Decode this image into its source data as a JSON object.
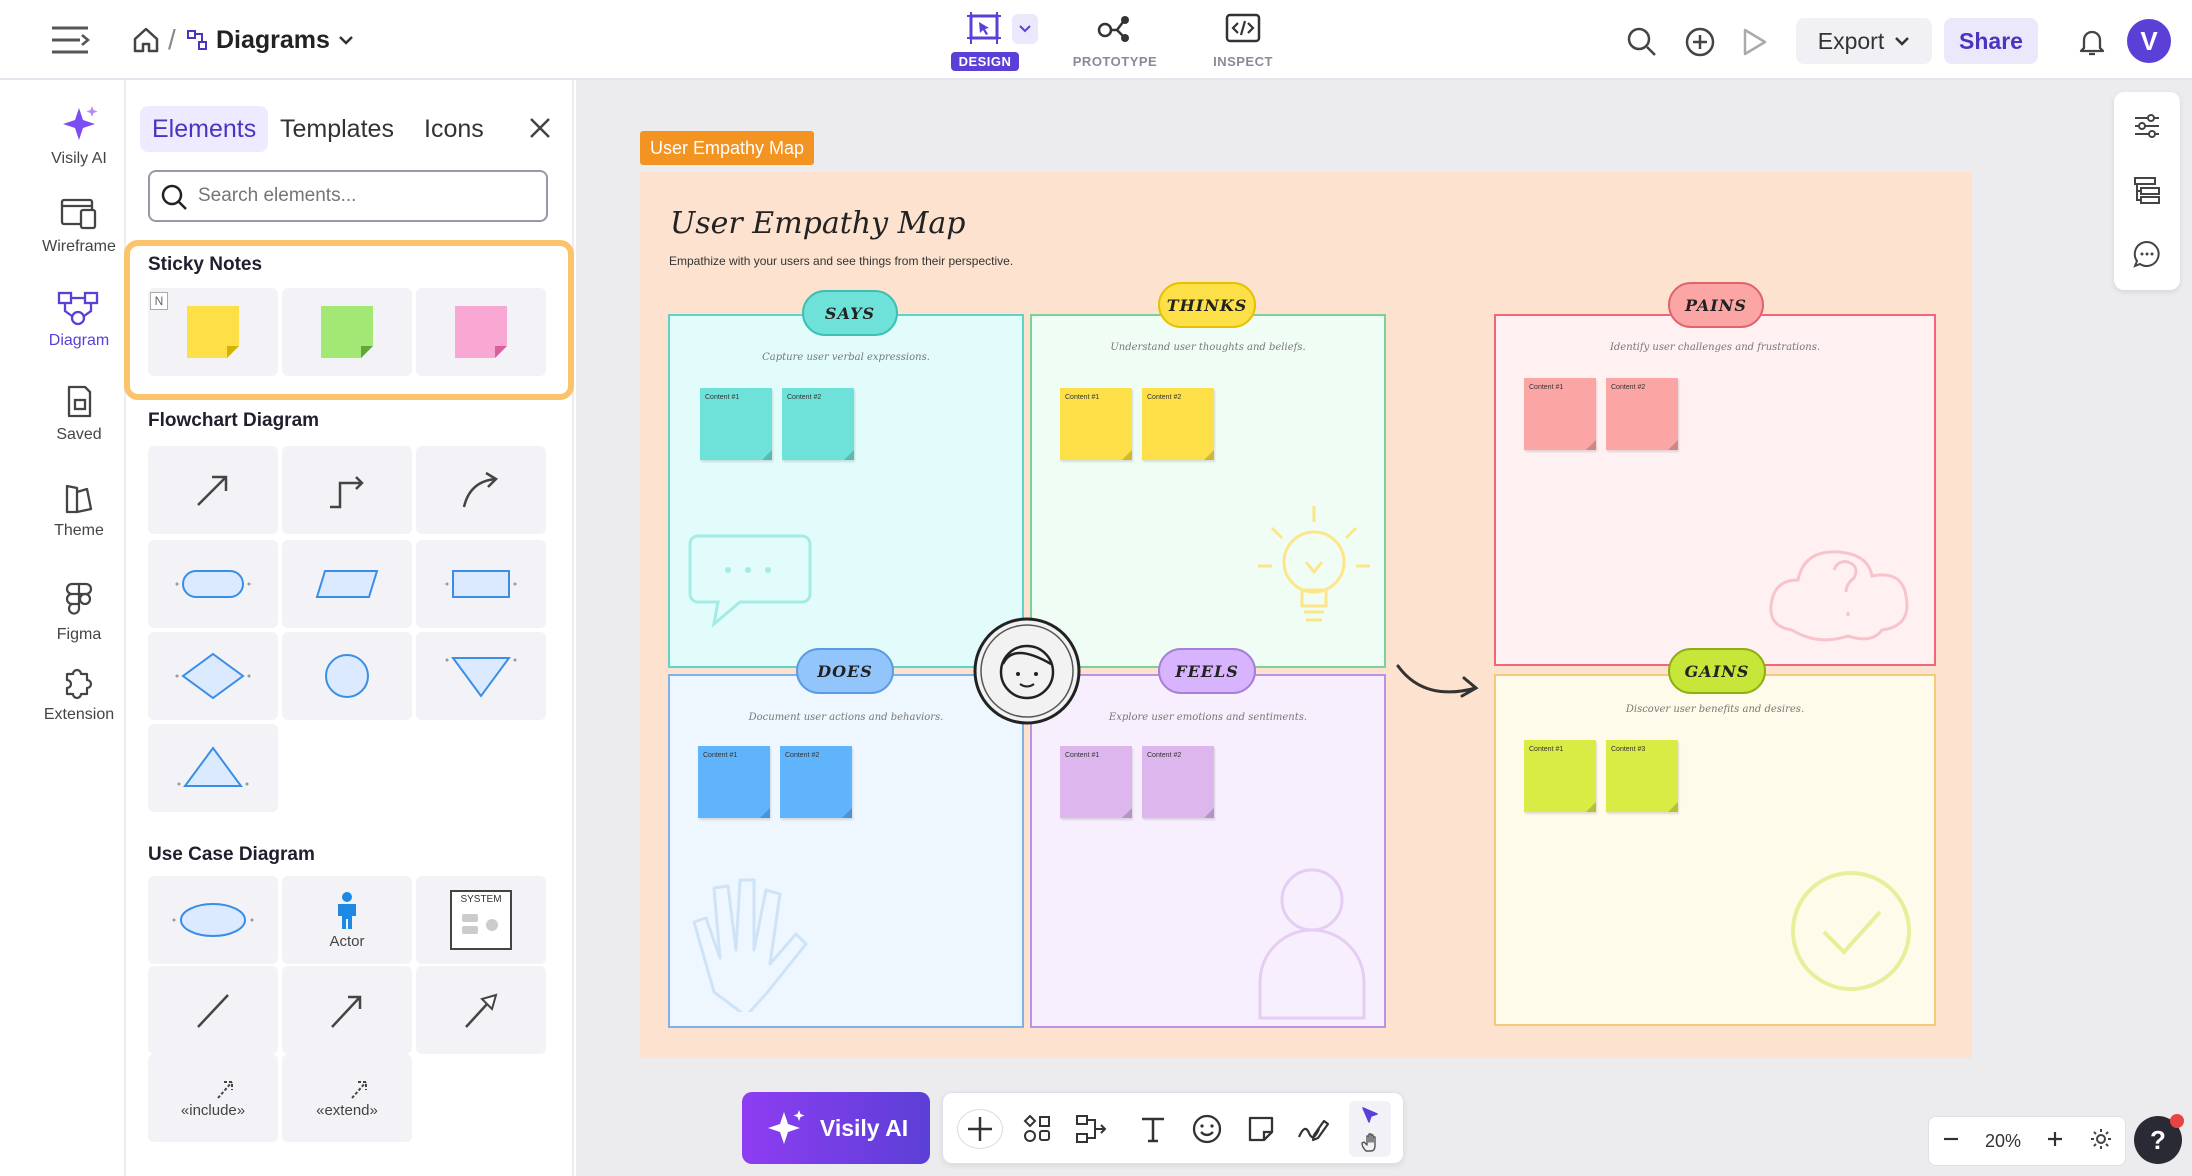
{
  "topbar": {
    "breadcrumb_sep": "/",
    "project_name": "Diagrams",
    "modes": [
      {
        "label": "DESIGN"
      },
      {
        "label": "PROTOTYPE"
      },
      {
        "label": "INSPECT"
      }
    ],
    "export_label": "Export",
    "share_label": "Share",
    "avatar_letter": "V"
  },
  "rail": {
    "items": [
      {
        "label": "Visily AI",
        "icon": "sparkle-icon"
      },
      {
        "label": "Wireframe",
        "icon": "wireframe-icon"
      },
      {
        "label": "Diagram",
        "icon": "diagram-icon"
      },
      {
        "label": "Saved",
        "icon": "saved-icon"
      },
      {
        "label": "Theme",
        "icon": "theme-icon"
      },
      {
        "label": "Figma",
        "icon": "figma-icon"
      },
      {
        "label": "Extension",
        "icon": "puzzle-icon"
      }
    ]
  },
  "panel": {
    "tabs": [
      {
        "label": "Elements"
      },
      {
        "label": "Templates"
      },
      {
        "label": "Icons"
      }
    ],
    "search_placeholder": "Search elements...",
    "sticky_title": "Sticky Notes",
    "sticky_badge": "N",
    "flowchart_title": "Flowchart Diagram",
    "usecase_title": "Use Case Diagram",
    "actor_label": "Actor",
    "system_label": "SYSTEM",
    "include_label": "«include»",
    "extend_label": "«extend»"
  },
  "canvas": {
    "frame_label": "User Empathy Map",
    "board_title": "User Empathy Map",
    "board_subtitle": "Empathize with your users and see things from their perspective.",
    "quadrants": {
      "says": {
        "label": "SAYS",
        "subtitle": "Capture user verbal expressions.",
        "notes": [
          "Content #1",
          "Content #2"
        ]
      },
      "thinks": {
        "label": "THINKS",
        "subtitle": "Understand user thoughts and beliefs.",
        "notes": [
          "Content #1",
          "Content #2"
        ]
      },
      "does": {
        "label": "DOES",
        "subtitle": "Document user actions and behaviors.",
        "notes": [
          "Content #1",
          "Content #2"
        ]
      },
      "feels": {
        "label": "FEELS",
        "subtitle": "Explore user emotions and sentiments.",
        "notes": [
          "Content #1",
          "Content #2"
        ]
      },
      "pains": {
        "label": "PAINS",
        "subtitle": "Identify user challenges and frustrations.",
        "notes": [
          "Content #1",
          "Content #2"
        ]
      },
      "gains": {
        "label": "GAINS",
        "subtitle": "Discover user benefits and desires.",
        "notes": [
          "Content #1",
          "Content #3"
        ]
      }
    },
    "colors": {
      "sticky_yellow": "#fde047",
      "sticky_green": "#a3e875",
      "sticky_pink": "#f9a8d4",
      "accent": "#5b3fd6",
      "highlight": "#fbc46a"
    }
  },
  "bottom": {
    "ai_label": "Visily AI",
    "zoom": "20%",
    "help": "?"
  }
}
